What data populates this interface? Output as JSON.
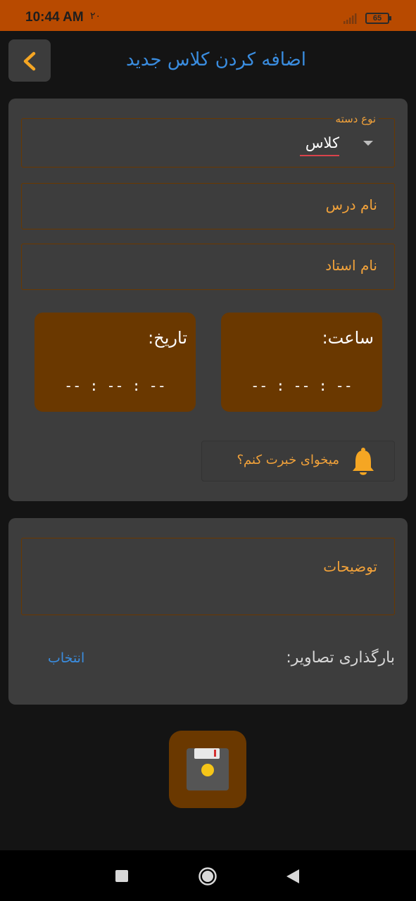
{
  "status_bar": {
    "time": "10:44 AM",
    "extra": "۲۰",
    "battery": "65",
    "background": "#b84a00"
  },
  "header": {
    "back_icon": "chevron-left-icon",
    "title": "اضافه کردن کلاس جدید",
    "title_color": "#3a8de0"
  },
  "form": {
    "category": {
      "legend": "نوع دسته",
      "value": "کلاس",
      "icon": "dropdown-arrow-icon"
    },
    "lesson_name": {
      "placeholder": "نام درس"
    },
    "teacher_name": {
      "placeholder": "نام استاد"
    },
    "time_tile": {
      "label": "ساعت:",
      "value": "-- : -- : --"
    },
    "date_tile": {
      "label": "تاریخ:",
      "value": "-- : -- : --"
    },
    "notify": {
      "label": "میخوای خبرت کنم؟",
      "icon": "bell-icon"
    }
  },
  "details": {
    "description": {
      "placeholder": "توضیحات"
    },
    "upload": {
      "label": "بارگذاری تصاویر:",
      "action": "انتخاب"
    }
  },
  "save_button": {
    "icon": "floppy-disk-icon"
  },
  "nav_bar": {
    "recents_icon": "square-icon",
    "home_icon": "circle-home-icon",
    "back_icon": "triangle-back-icon"
  },
  "colors": {
    "accent_orange": "#f2a23a",
    "tile_brown": "#6a3800",
    "card_bg": "#3d3d3d",
    "page_bg": "#141414"
  }
}
